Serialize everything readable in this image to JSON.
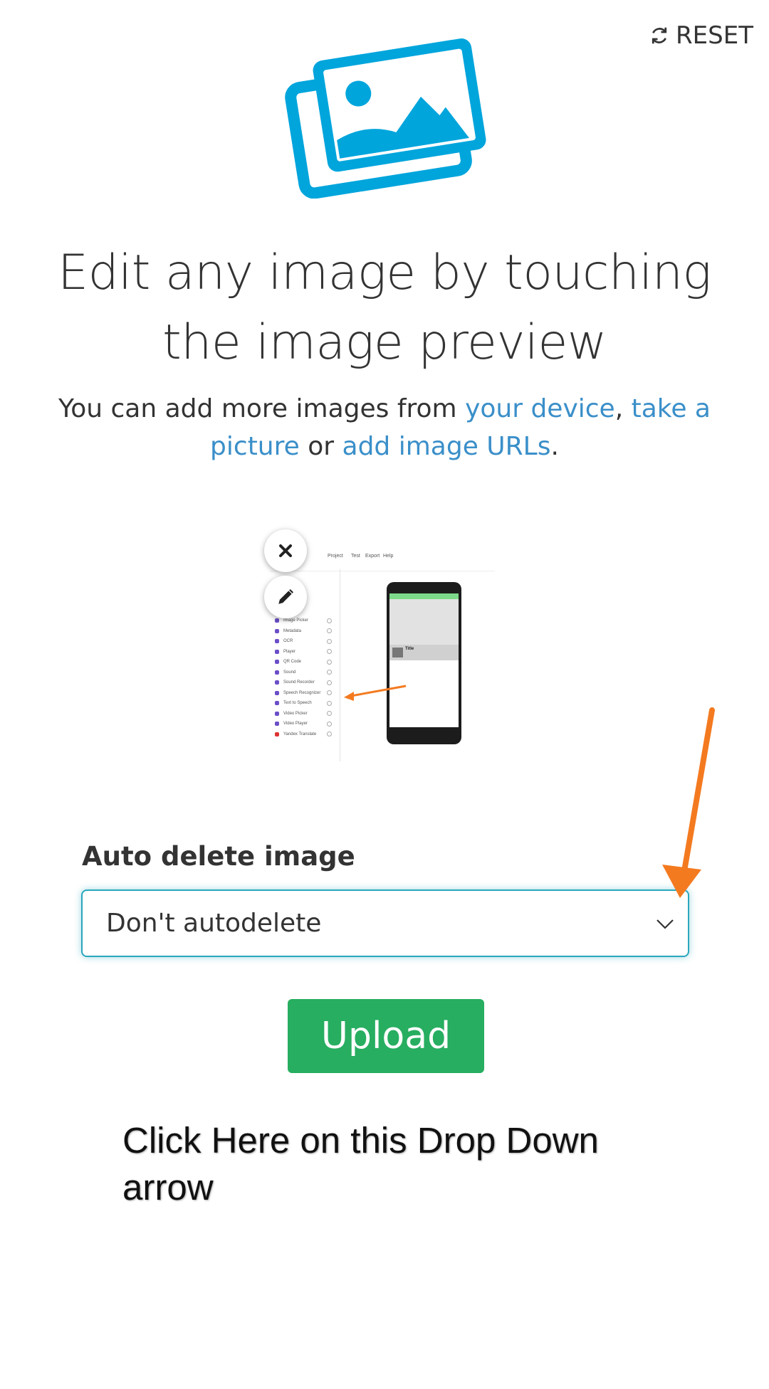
{
  "header": {
    "reset_label": "RESET"
  },
  "hero": {
    "headline": "Edit any image by touching the image preview",
    "subtext_before": "You can add more images from ",
    "link_device": "your device",
    "subtext_comma": ", ",
    "link_picture": "take a picture",
    "subtext_or": " or ",
    "link_urls": "add image URLs",
    "subtext_end": "."
  },
  "preview": {
    "menu_items": [
      "Project",
      "Test",
      "Export",
      "Help"
    ],
    "list_items": [
      "Image Picker",
      "Metadata",
      "OCR",
      "Player",
      "QR Code",
      "Sound",
      "Sound Recorder",
      "Speech Recognizer",
      "Text to Speech",
      "Video Picker",
      "Video Player",
      "Yandex Translate"
    ],
    "phone_title": "Title"
  },
  "form": {
    "label": "Auto delete image",
    "select_value": "Don't autodelete",
    "upload_label": "Upload"
  },
  "annotation": {
    "text": "Click Here on this Drop Down\n arrow"
  },
  "colors": {
    "accent": "#00a5dc",
    "link": "#3a8fc9",
    "button": "#27ae60",
    "arrow": "#f47a20",
    "focus": "#2aa7bd"
  }
}
